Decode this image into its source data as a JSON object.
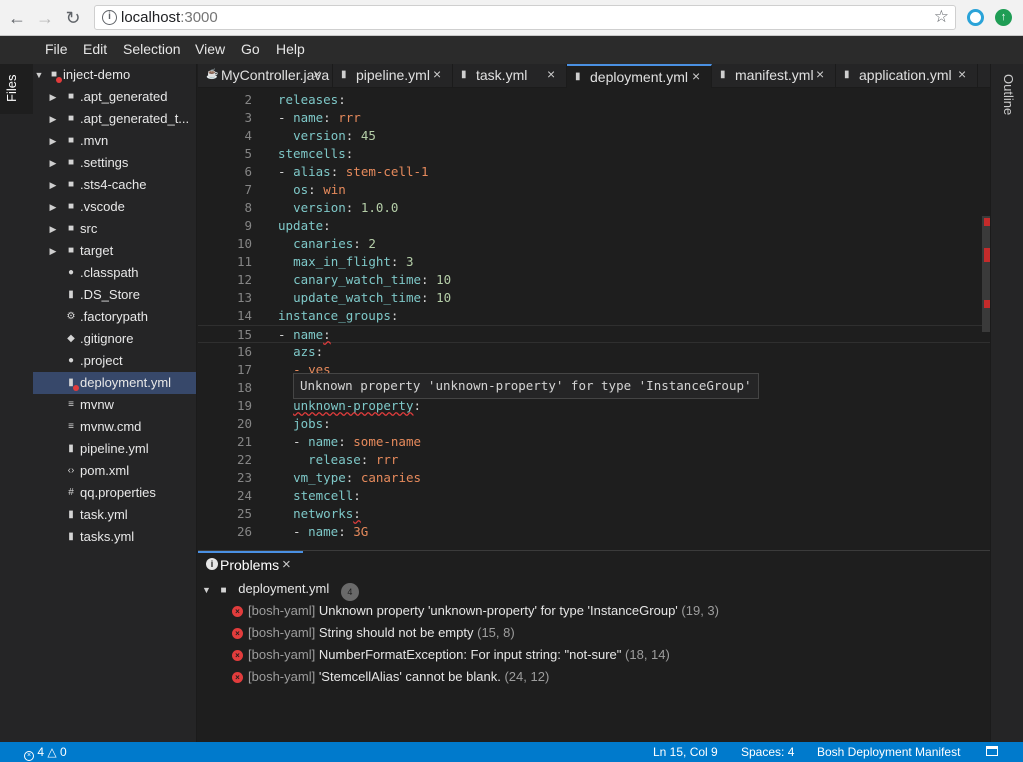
{
  "browser": {
    "url_host": "localhost",
    "url_port": ":3000",
    "back_icon": "arrow-left-icon",
    "forward_icon": "arrow-right-icon",
    "reload_icon": "reload-icon",
    "star_icon": "star-icon"
  },
  "menu": {
    "file": "File",
    "edit": "Edit",
    "selection": "Selection",
    "view": "View",
    "go": "Go",
    "help": "Help"
  },
  "side": {
    "files": "Files",
    "outline": "Outline"
  },
  "explorer": {
    "root": "inject-demo",
    "items": [
      {
        "label": ".apt_generated"
      },
      {
        "label": ".apt_generated_t..."
      },
      {
        "label": ".mvn"
      },
      {
        "label": ".settings"
      },
      {
        "label": ".sts4-cache"
      },
      {
        "label": ".vscode"
      },
      {
        "label": "src"
      },
      {
        "label": "target"
      },
      {
        "label": ".classpath"
      },
      {
        "label": ".DS_Store"
      },
      {
        "label": ".factorypath"
      },
      {
        "label": ".gitignore"
      },
      {
        "label": ".project"
      },
      {
        "label": "deployment.yml"
      },
      {
        "label": "mvnw"
      },
      {
        "label": "mvnw.cmd"
      },
      {
        "label": "pipeline.yml"
      },
      {
        "label": "pom.xml"
      },
      {
        "label": "qq.properties"
      },
      {
        "label": "task.yml"
      },
      {
        "label": "tasks.yml"
      }
    ]
  },
  "tabs": [
    {
      "label": "MyController.java"
    },
    {
      "label": "pipeline.yml"
    },
    {
      "label": "task.yml"
    },
    {
      "label": "deployment.yml"
    },
    {
      "label": "manifest.yml"
    },
    {
      "label": "application.yml"
    }
  ],
  "editor": {
    "lines": [
      {
        "n": "2",
        "key": "releases",
        "sep": ":",
        "val": ""
      },
      {
        "n": "3",
        "pre": "- ",
        "key": "name",
        "sep": ": ",
        "val": "rrr"
      },
      {
        "n": "4",
        "pre": "  ",
        "key": "version",
        "sep": ": ",
        "val": "45"
      },
      {
        "n": "5",
        "key": "stemcells",
        "sep": ":",
        "val": ""
      },
      {
        "n": "6",
        "pre": "- ",
        "key": "alias",
        "sep": ": ",
        "val": "stem-cell-1"
      },
      {
        "n": "7",
        "pre": "  ",
        "key": "os",
        "sep": ": ",
        "val": "win"
      },
      {
        "n": "8",
        "pre": "  ",
        "key": "version",
        "sep": ": ",
        "val": "1.0.0"
      },
      {
        "n": "9",
        "key": "update",
        "sep": ":",
        "val": ""
      },
      {
        "n": "10",
        "pre": "  ",
        "key": "canaries",
        "sep": ": ",
        "val": "2"
      },
      {
        "n": "11",
        "pre": "  ",
        "key": "max_in_flight",
        "sep": ": ",
        "val": "3"
      },
      {
        "n": "12",
        "pre": "  ",
        "key": "canary_watch_time",
        "sep": ": ",
        "val": "10"
      },
      {
        "n": "13",
        "pre": "  ",
        "key": "update_watch_time",
        "sep": ": ",
        "val": "10"
      },
      {
        "n": "14",
        "key": "instance_groups",
        "sep": ":",
        "val": ""
      },
      {
        "n": "15",
        "pre": "- ",
        "key": "name",
        "sep": ":",
        "val": ""
      },
      {
        "n": "16",
        "pre": "  ",
        "key": "azs",
        "sep": ":",
        "val": ""
      },
      {
        "n": "17",
        "pre": "  ",
        "key": "- yes",
        "sep": "",
        "val": ""
      },
      {
        "n": "18",
        "key": "",
        "sep": "",
        "val": ""
      },
      {
        "n": "19",
        "pre": "  ",
        "key": "unknown-property",
        "sep": ":",
        "val": ""
      },
      {
        "n": "20",
        "pre": "  ",
        "key": "jobs",
        "sep": ":",
        "val": ""
      },
      {
        "n": "21",
        "pre": "  - ",
        "key": "name",
        "sep": ": ",
        "val": "some-name"
      },
      {
        "n": "22",
        "pre": "    ",
        "key": "release",
        "sep": ": ",
        "val": "rrr"
      },
      {
        "n": "23",
        "pre": "  ",
        "key": "vm_type",
        "sep": ": ",
        "val": "canaries"
      },
      {
        "n": "24",
        "pre": "  ",
        "key": "stemcell",
        "sep": ":",
        "val": ""
      },
      {
        "n": "25",
        "pre": "  ",
        "key": "networks",
        "sep": ":",
        "val": ""
      },
      {
        "n": "26",
        "pre": "  - ",
        "key": "name",
        "sep": ": ",
        "val": "3G"
      }
    ],
    "tooltip": "Unknown property 'unknown-property' for type 'InstanceGroup'"
  },
  "problems": {
    "tab_label": "Problems",
    "file": "deployment.yml",
    "count": "4",
    "items": [
      {
        "source": "[bosh-yaml]",
        "message": "Unknown property 'unknown-property' for type 'InstanceGroup'",
        "position": "(19, 3)"
      },
      {
        "source": "[bosh-yaml]",
        "message": "String should not be empty",
        "position": "(15, 8)"
      },
      {
        "source": "[bosh-yaml]",
        "message": "NumberFormatException: For input string: \"not-sure\"",
        "position": "(18, 14)"
      },
      {
        "source": "[bosh-yaml]",
        "message": "'StemcellAlias' cannot be blank.",
        "position": "(24, 12)"
      }
    ]
  },
  "status": {
    "errors": "4",
    "warnings": "0",
    "position": "Ln 15, Col 9",
    "spaces": "Spaces: 4",
    "language": "Bosh Deployment Manifest"
  },
  "colors": {
    "accent": "#007acc",
    "error": "#e23c3c",
    "key": "#7ec8c8",
    "string": "#e68a5c",
    "number": "#b5cea8"
  }
}
